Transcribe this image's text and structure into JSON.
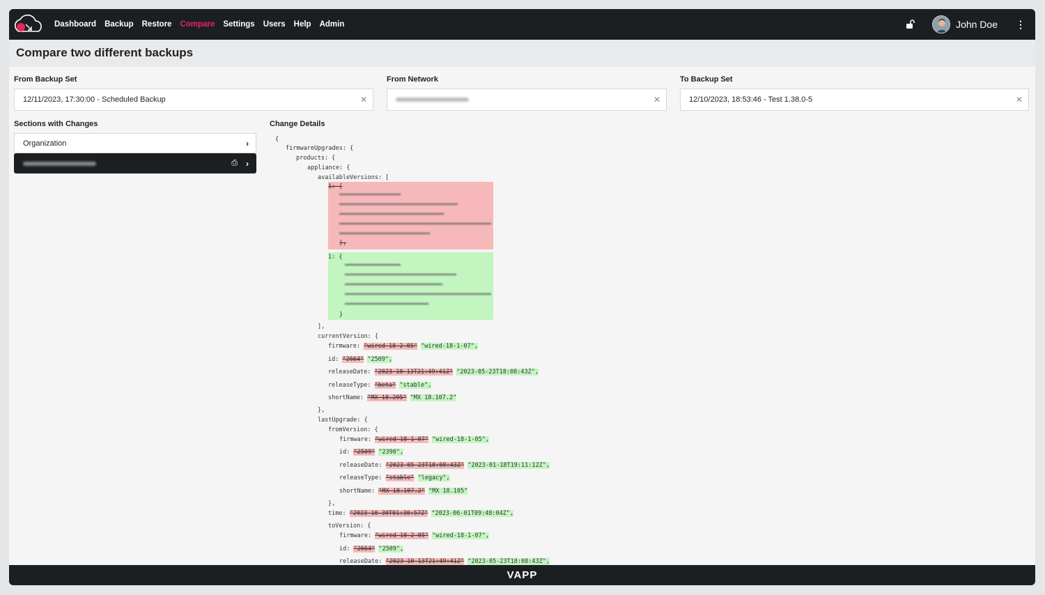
{
  "nav": {
    "items": [
      "Dashboard",
      "Backup",
      "Restore",
      "Compare",
      "Settings",
      "Users",
      "Help",
      "Admin"
    ],
    "active": "Compare",
    "accent_color": "#e8265e"
  },
  "user": {
    "name": "John Doe",
    "avatar_icon": "user-avatar",
    "menu_icon": "kebab-icon"
  },
  "page": {
    "title": "Compare two different backups"
  },
  "filters": {
    "from_backup_label": "From Backup Set",
    "from_backup_value": "12/11/2023, 17:30:00 - Scheduled Backup",
    "from_network_label": "From Network",
    "to_backup_label": "To Backup Set",
    "to_backup_value": "12/10/2023, 18:53:46 - Test 1.38.0-5"
  },
  "sections": {
    "label": "Sections with Changes",
    "items": [
      "Organization"
    ]
  },
  "details": {
    "label": "Change Details",
    "lines": {
      "l0": "{",
      "l1": "firmwareUpgrades: {",
      "l2": "products: {",
      "l3": "appliance: {",
      "l4": "availableVersions: [",
      "l5del": "1: {",
      "l5delEnd": "},",
      "l6add": "1: {",
      "l6addEnd": "}",
      "l7": "],",
      "cv": "currentVersion: {",
      "cv_fw_key": "firmware: ",
      "cv_fw_old": "\"wired-18-2-05\"",
      "cv_fw_new": "\"wired-18-1-07\",",
      "cv_id_key": "id: ",
      "cv_id_old": "\"2664\"",
      "cv_id_new": "\"2509\",",
      "cv_rd_key": "releaseDate: ",
      "cv_rd_old": "\"2023-10-13T21:49:41Z\"",
      "cv_rd_new": "\"2023-05-23T18:08:43Z\",",
      "cv_rt_key": "releaseType: ",
      "cv_rt_old": "\"beta\"",
      "cv_rt_new": "\"stable\",",
      "cv_sn_key": "shortName: ",
      "cv_sn_old": "\"MX 18.205\"",
      "cv_sn_new": "\"MX 18.107.2\"",
      "cv_end": "},",
      "lu": "lastUpgrade: {",
      "fv": "fromVersion: {",
      "fv_fw_key": "firmware: ",
      "fv_fw_old": "\"wired-18-1-07\"",
      "fv_fw_new": "\"wired-18-1-05\",",
      "fv_id_key": "id: ",
      "fv_id_old": "\"2509\"",
      "fv_id_new": "\"2390\",",
      "fv_rd_key": "releaseDate: ",
      "fv_rd_old": "\"2023-05-23T18:08:43Z\"",
      "fv_rd_new": "\"2023-01-18T19:11:12Z\",",
      "fv_rt_key": "releaseType: ",
      "fv_rt_old": "\"stable\"",
      "fv_rt_new": "\"legacy\",",
      "fv_sn_key": "shortName: ",
      "fv_sn_old": "\"MX 18.107.2\"",
      "fv_sn_new": "\"MX 18.105\"",
      "fv_end": "},",
      "tm_key": "time: ",
      "tm_old": "\"2023-10-30T01:30:57Z\"",
      "tm_new": "\"2023-06-01T09:48:04Z\",",
      "tv": "toVersion: {",
      "tv_fw_key": "firmware: ",
      "tv_fw_old": "\"wired-18-2-05\"",
      "tv_fw_new": "\"wired-18-1-07\",",
      "tv_id_key": "id: ",
      "tv_id_old": "\"2664\"",
      "tv_id_new": "\"2509\",",
      "tv_rd_key": "releaseDate: ",
      "tv_rd_old": "\"2023-10-13T21:49:41Z\"",
      "tv_rd_new": "\"2023-05-23T18:08:43Z\","
    }
  },
  "footer": {
    "brand": "VAPP"
  },
  "colors": {
    "removed": "#f6b8b8",
    "added": "#c2f5c0",
    "topbar": "#1c1f22"
  }
}
